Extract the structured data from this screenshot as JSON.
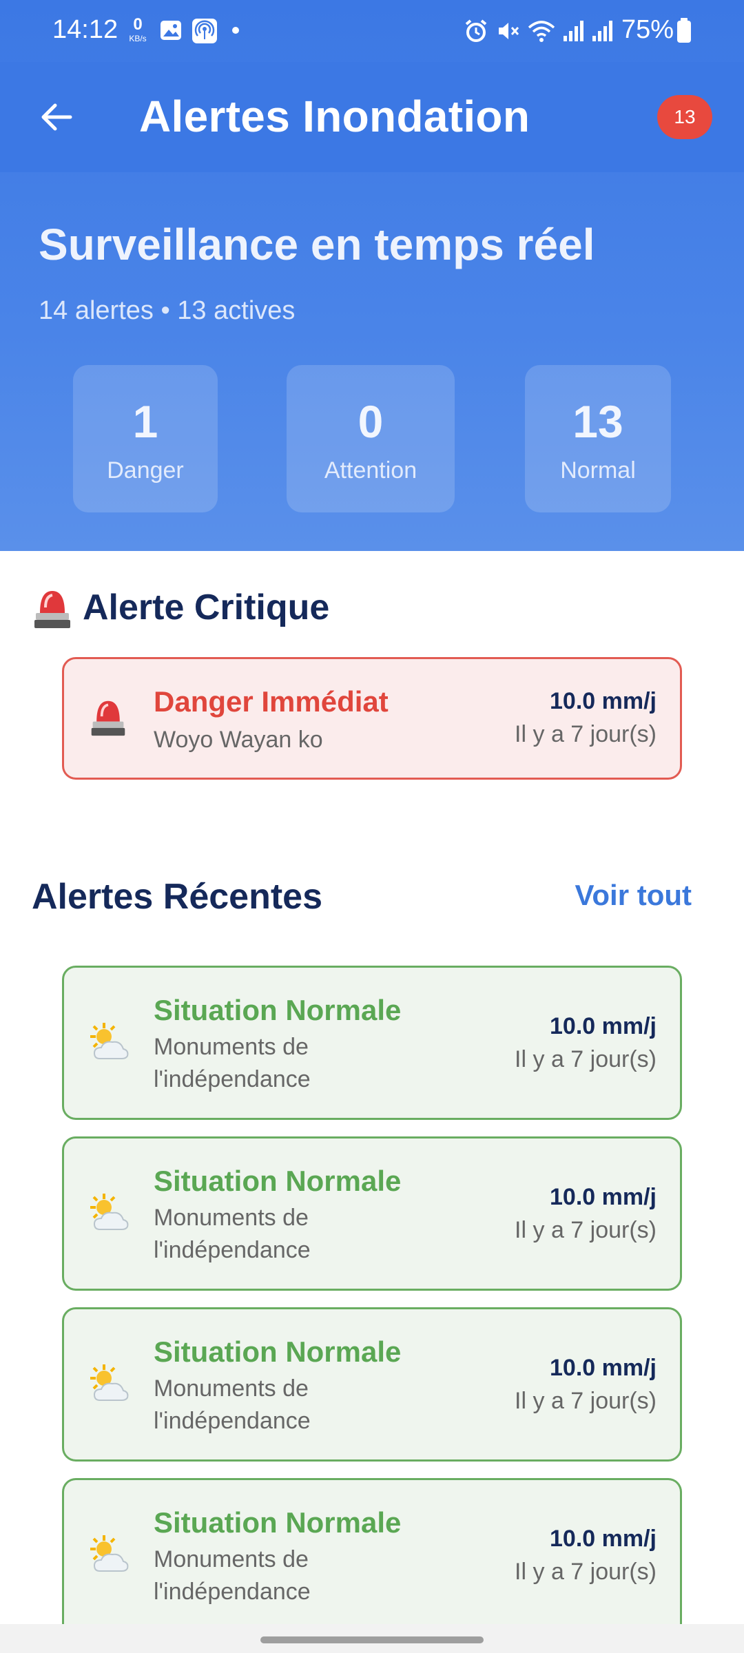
{
  "status_bar": {
    "time": "14:12",
    "net_speed_value": "0",
    "net_speed_unit": "KB/s",
    "battery": "75%"
  },
  "app_bar": {
    "title": "Alertes Inondation",
    "badge_count": "13"
  },
  "hero": {
    "title": "Surveillance en temps réel",
    "subtitle": "14 alertes • 13 actives",
    "stats": [
      {
        "value": "1",
        "label": "Danger"
      },
      {
        "value": "0",
        "label": "Attention"
      },
      {
        "value": "13",
        "label": "Normal"
      }
    ]
  },
  "critical": {
    "section_title": "Alerte Critique",
    "card": {
      "title": "Danger Immédiat",
      "location": "Woyo Wayan ko",
      "value": "10.0 mm/j",
      "time": "Il y a 7 jour(s)"
    }
  },
  "recent": {
    "section_title": "Alertes Récentes",
    "see_all": "Voir tout",
    "items": [
      {
        "title": "Situation Normale",
        "location": "Monuments de l'indépendance",
        "value": "10.0 mm/j",
        "time": "Il y a 7 jour(s)"
      },
      {
        "title": "Situation Normale",
        "location": "Monuments de l'indépendance",
        "value": "10.0 mm/j",
        "time": "Il y a 7 jour(s)"
      },
      {
        "title": "Situation Normale",
        "location": "Monuments de l'indépendance",
        "value": "10.0 mm/j",
        "time": "Il y a 7 jour(s)"
      },
      {
        "title": "Situation Normale",
        "location": "Monuments de l'indépendance",
        "value": "10.0 mm/j",
        "time": "Il y a 7 jour(s)"
      }
    ]
  },
  "colors": {
    "primary": "#3c78e4",
    "danger": "#e25b52",
    "normal": "#69ad61",
    "text_dark": "#15295a"
  },
  "icons": [
    "back-arrow-icon",
    "siren-icon",
    "sun-cloud-icon",
    "image-icon",
    "hotspot-icon",
    "alarm-icon",
    "mute-icon",
    "wifi-icon",
    "signal-icon",
    "battery-icon"
  ]
}
